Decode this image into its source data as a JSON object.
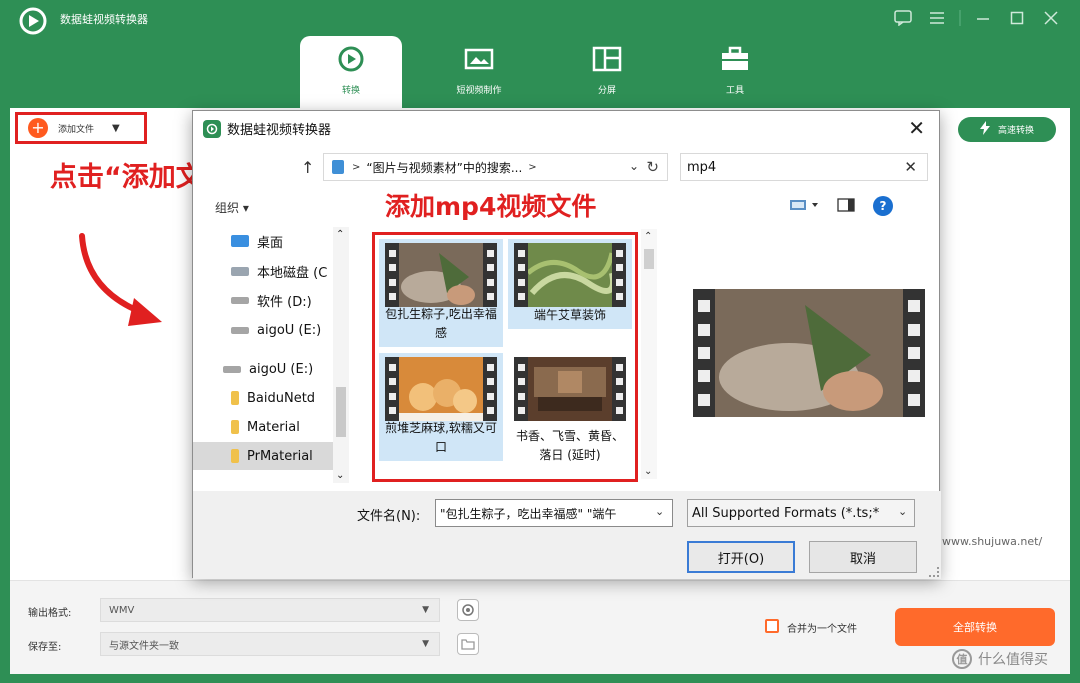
{
  "app": {
    "title": "数据蛙视频转换器",
    "brand_color": "#2e8f55",
    "tabs": [
      {
        "label": "转换",
        "icon": "convert-icon",
        "active": true
      },
      {
        "label": "短视频制作",
        "icon": "video-maker-icon",
        "active": false
      },
      {
        "label": "分屏",
        "icon": "split-screen-icon",
        "active": false
      },
      {
        "label": "工具",
        "icon": "toolbox-icon",
        "active": false
      }
    ],
    "window_controls": [
      "feedback-icon",
      "menu-icon",
      "minimize-icon",
      "maximize-icon",
      "close-icon"
    ]
  },
  "toolbar": {
    "add_file_label": "添加文件",
    "fast_convert_label": "高速转换"
  },
  "annotations": {
    "click_add": "点击“添加文件”",
    "add_mp4": "添加mp4视频文件",
    "annotation_color": "#e02020"
  },
  "dialog": {
    "title": "数据蛙视频转换器",
    "path": "“图片与视频素材”中的搜索...",
    "search_value": "mp4",
    "organize_label": "组织 ▾",
    "nav_items": [
      {
        "label": "桌面",
        "icon": "desktop-icon",
        "selected": false
      },
      {
        "label": "本地磁盘 (C",
        "icon": "drive-icon",
        "selected": false
      },
      {
        "label": "软件 (D:)",
        "icon": "drive-icon",
        "selected": false
      },
      {
        "label": "aigoU (E:)",
        "icon": "drive-icon",
        "selected": false
      },
      {
        "label": "aigoU (E:)",
        "icon": "usb-drive-icon",
        "selected": false
      },
      {
        "label": "BaiduNetd",
        "icon": "folder-icon",
        "selected": false
      },
      {
        "label": "Material",
        "icon": "folder-icon",
        "selected": false
      },
      {
        "label": "PrMaterial",
        "icon": "folder-icon",
        "selected": true
      }
    ],
    "files": [
      {
        "name": "包扎生粽子,吃出幸福感",
        "selected": true
      },
      {
        "name": "端午艾草装饰",
        "selected": true
      },
      {
        "name": "煎堆芝麻球,软糯又可口",
        "selected": true
      },
      {
        "name": "书香、飞雪、黄昏、落日 (延时)",
        "selected": false
      }
    ],
    "filename_label": "文件名(N):",
    "filename_value": "\"包扎生粽子，吃出幸福感\" \"端午",
    "filter_value": "All Supported Formats (*.ts;*",
    "open_label": "打开(O)",
    "cancel_label": "取消"
  },
  "bottom": {
    "output_format_label": "输出格式:",
    "output_format_value": "WMV",
    "save_to_label": "保存至:",
    "save_to_value": "与源文件夹一致",
    "merge_label": "合并为一个文件",
    "convert_all_label": "全部转换",
    "accent_color": "#ff6a2b"
  },
  "watermarks": {
    "url": "www.shujuwa.net/",
    "site": "什么值得买",
    "site_badge": "值"
  }
}
